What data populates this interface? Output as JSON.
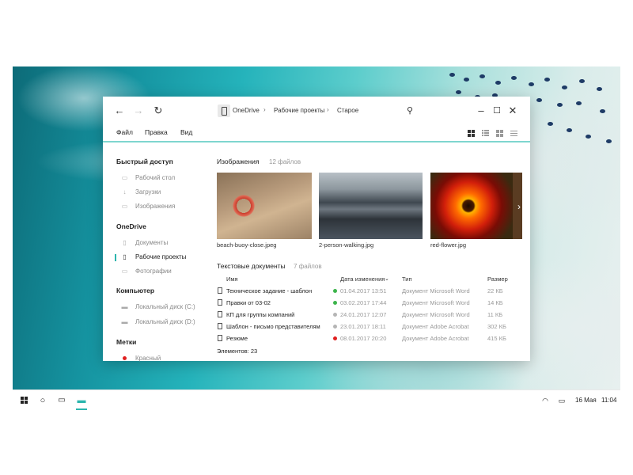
{
  "colors": {
    "accent": "#2bb5ad",
    "accent_line": "#7fd6cf",
    "label_red": "#e02020",
    "dot_green": "#3cb44b",
    "dot_gray": "#b5b5b5",
    "dot_red": "#e02020"
  },
  "window": {
    "nav_icons": [
      "back-arrow-icon",
      "forward-arrow-icon",
      "refresh-icon"
    ],
    "breadcrumb": [
      "OneDrive",
      "Рабочие проекты",
      "Старое"
    ],
    "controls": [
      "minimize-icon",
      "maximize-icon",
      "close-icon"
    ],
    "search_icon": "search-icon"
  },
  "menu": {
    "file": "Файл",
    "edit": "Правка",
    "view": "Вид"
  },
  "view_icons": [
    "large-icons-view-icon",
    "details-view-icon",
    "tiles-view-icon",
    "list-view-icon"
  ],
  "sidebar": {
    "quick_access": {
      "title": "Быстрый доступ",
      "items": [
        {
          "label": "Рабочий стол",
          "icon": "desktop-icon"
        },
        {
          "label": "Загрузки",
          "icon": "download-icon"
        },
        {
          "label": "Изображения",
          "icon": "image-icon"
        }
      ]
    },
    "onedrive": {
      "title": "OneDrive",
      "items": [
        {
          "label": "Документы",
          "icon": "document-icon"
        },
        {
          "label": "Рабочие проекты",
          "icon": "phone-icon",
          "active": true
        },
        {
          "label": "Фотографии",
          "icon": "photo-icon"
        }
      ]
    },
    "computer": {
      "title": "Компьютер",
      "items": [
        {
          "label": "Локальный диск (C:)",
          "icon": "drive-icon"
        },
        {
          "label": "Локальный диск (D:)",
          "icon": "drive-icon"
        }
      ]
    },
    "tags": {
      "title": "Метки",
      "items": [
        {
          "label": "Красный",
          "icon": "red-dot-icon"
        }
      ]
    }
  },
  "images_section": {
    "title": "Изображения",
    "count": "12 файлов",
    "items": [
      {
        "caption": "beach-buoy-close.jpeg"
      },
      {
        "caption": "2-person-walking.jpg"
      },
      {
        "caption": "red-flower.jpg"
      }
    ]
  },
  "docs_section": {
    "title": "Текстовые документы",
    "count": "7 файлов",
    "columns": {
      "name": "Имя",
      "date": "Дата изменения",
      "type": "Тип",
      "size": "Размер"
    },
    "rows": [
      {
        "name": "Техническое задание - шаблон",
        "date": "01.04.2017 13:51",
        "type": "Документ Microsoft Word",
        "size": "22 КБ",
        "dot": "green"
      },
      {
        "name": "Правки от 03-02",
        "date": "03.02.2017 17:44",
        "type": "Документ Microsoft Word",
        "size": "14 КБ",
        "dot": "green"
      },
      {
        "name": "КП для группы компаний",
        "date": "24.01.2017 12:07",
        "type": "Документ Microsoft Word",
        "size": "11 КБ",
        "dot": "gray"
      },
      {
        "name": "Шаблон - письмо представителям",
        "date": "23.01.2017 18:11",
        "type": "Документ Adobe Acrobat",
        "size": "302 КБ",
        "dot": "gray"
      },
      {
        "name": "Резюме",
        "date": "08.01.2017 20:20",
        "type": "Документ Adobe Acrobat",
        "size": "415 КБ",
        "dot": "red"
      }
    ]
  },
  "status_bar": {
    "text": "Элементов: 23"
  },
  "taskbar": {
    "icons": [
      "windows-start-icon",
      "search-circle-icon",
      "task-view-icon",
      "file-explorer-icon"
    ],
    "tray_icons": [
      "wifi-icon",
      "battery-icon"
    ],
    "date": "16 Мая",
    "time": "11:04"
  }
}
